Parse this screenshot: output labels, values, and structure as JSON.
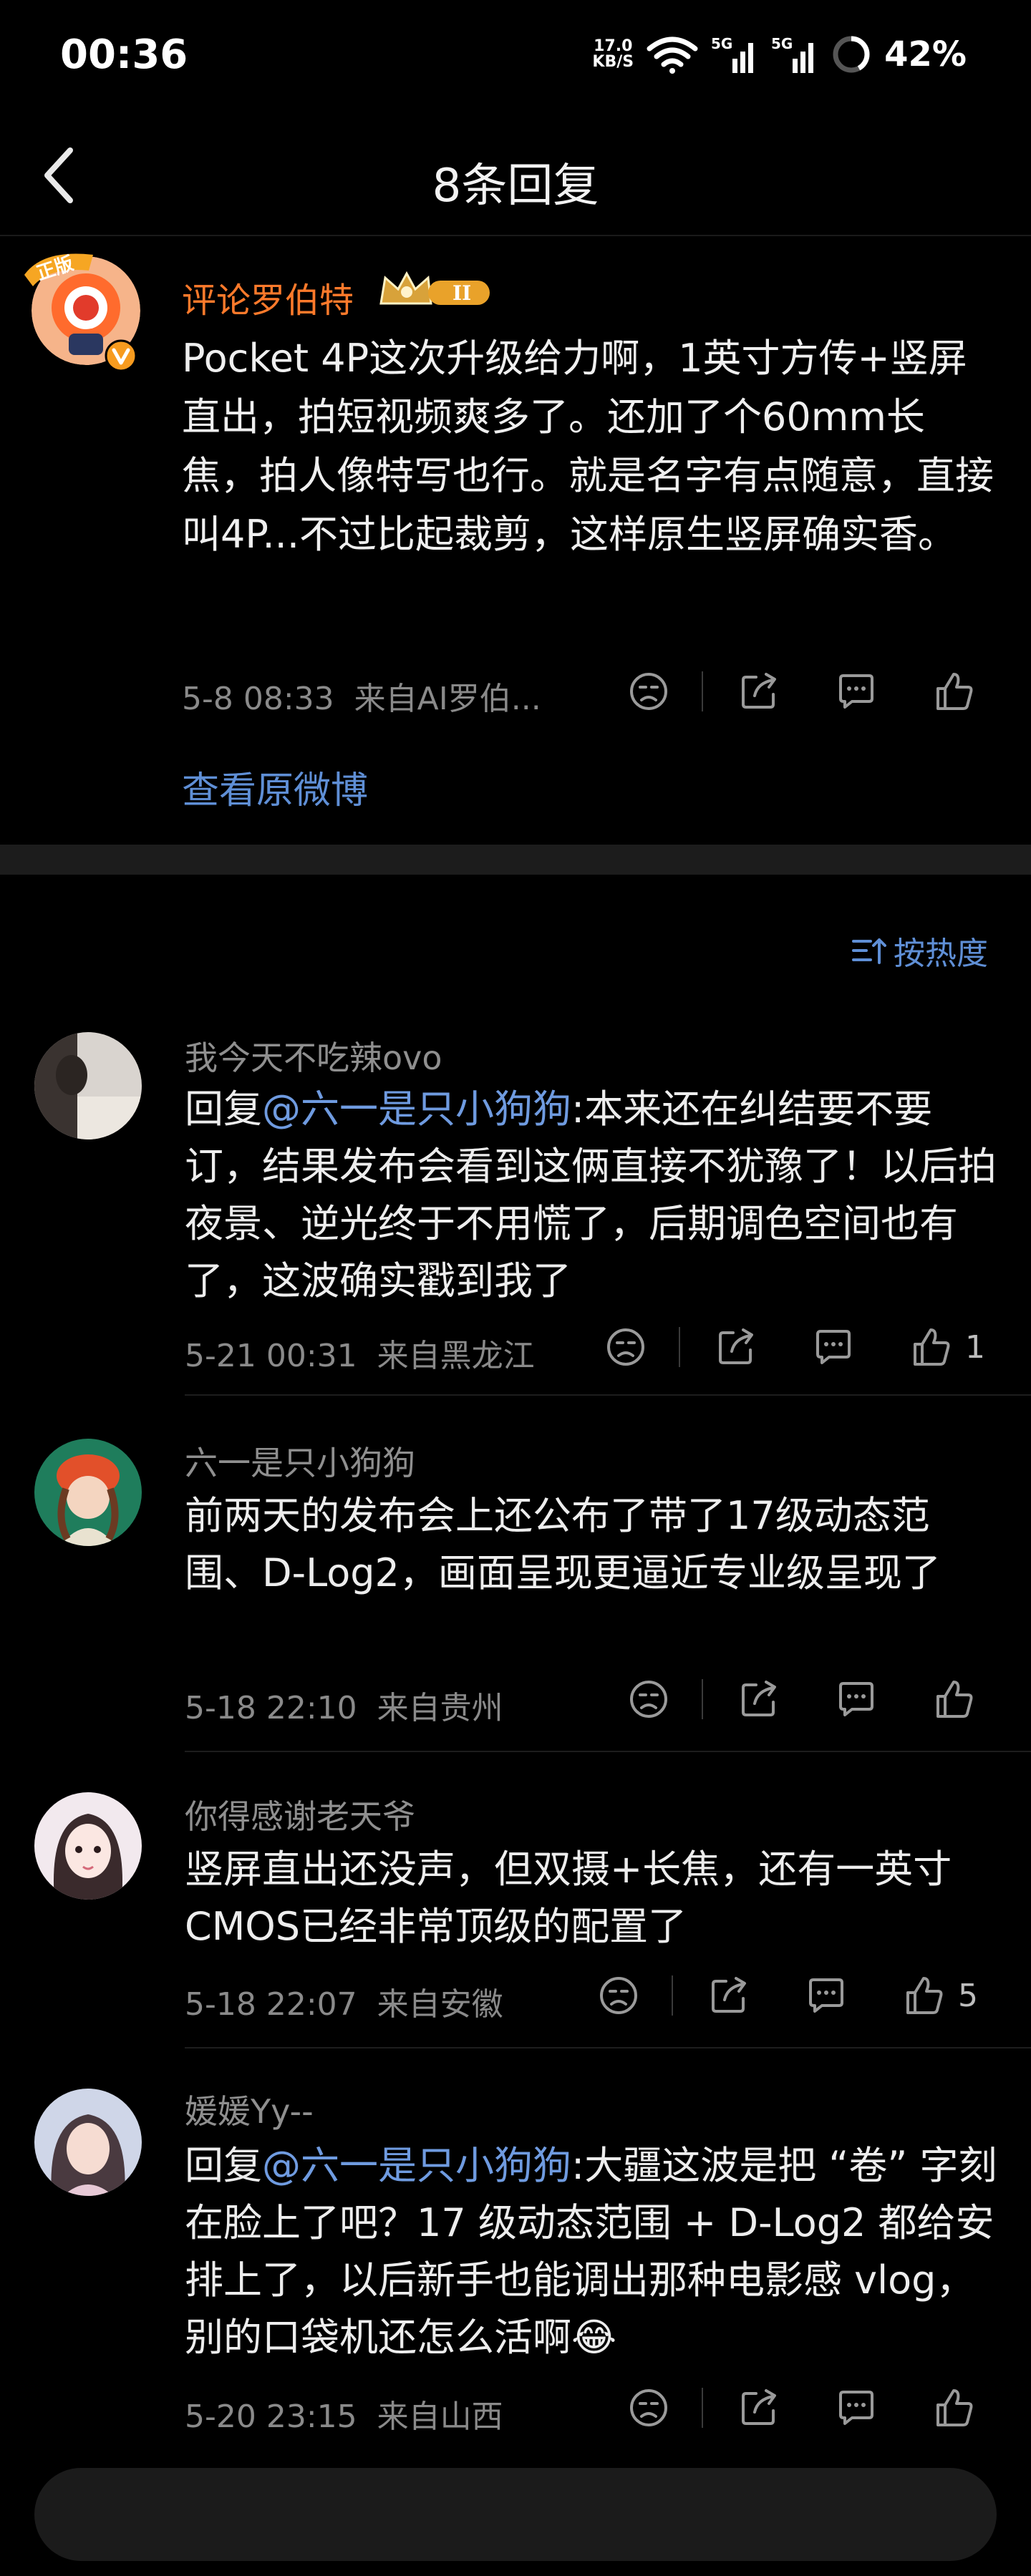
{
  "status_bar": {
    "time": "00:36",
    "speed_value": "17.0",
    "speed_unit": "KB/S",
    "sim1": "5G",
    "sim2": "5G",
    "battery": "42%"
  },
  "header": {
    "title": "8条回复"
  },
  "main_post": {
    "username": "评论罗伯特",
    "badge_text": "正版",
    "level_badge": "II",
    "text": "Pocket 4P这次升级给力啊，1英寸方传+竖屏直出，拍短视频爽多了。还加了个60mm长焦，拍人像特写也行。就是名字有点随意，直接叫4P...不过比起裁剪，这样原生竖屏确实香。",
    "timestamp": "5-8 08:33",
    "source": "来自AI罗伯...",
    "view_original": "查看原微博"
  },
  "sort_label": "按热度",
  "replies": [
    {
      "name": "我今天不吃辣ovo",
      "prefix": "回复",
      "mention": "@六一是只小狗狗",
      "text": ":本来还在纠结要不要订，结果发布会看到这俩直接不犹豫了！以后拍夜景、逆光终于不用慌了，后期调色空间也有了，这波确实戳到我了",
      "timestamp": "5-21 00:31",
      "source": "来自黑龙江",
      "likes": "1"
    },
    {
      "name": "六一是只小狗狗",
      "prefix": "",
      "mention": "",
      "text": "前两天的发布会上还公布了带了17级动态范围、D-Log2，画面呈现更逼近专业级呈现了",
      "timestamp": "5-18 22:10",
      "source": "来自贵州",
      "likes": ""
    },
    {
      "name": "你得感谢老天爷",
      "prefix": "",
      "mention": "",
      "text": "竖屏直出还没声，但双摄+长焦，还有一英寸CMOS已经非常顶级的配置了",
      "timestamp": "5-18 22:07",
      "source": "来自安徽",
      "likes": "5"
    },
    {
      "name": "媛媛Yy--",
      "prefix": "回复",
      "mention": "@六一是只小狗狗",
      "text": ":大疆这波是把 “卷” 字刻在脸上了吧？17 级动态范围 + D-Log2 都给安排上了，以后新手也能调出那种电影感 vlog，别的口袋机还怎么活啊😂",
      "timestamp": "5-20 23:15",
      "source": "来自山西",
      "likes": ""
    }
  ],
  "colors": {
    "background": "#000000",
    "username_orange": "#ff7a2b",
    "link_blue": "#5f8fd6",
    "meta_gray": "#8a8a8a"
  },
  "icons": [
    "back-icon",
    "dislike-icon",
    "share-icon",
    "comment-icon",
    "like-icon",
    "sort-icon",
    "wifi-icon",
    "signal-icon",
    "battery-icon"
  ]
}
